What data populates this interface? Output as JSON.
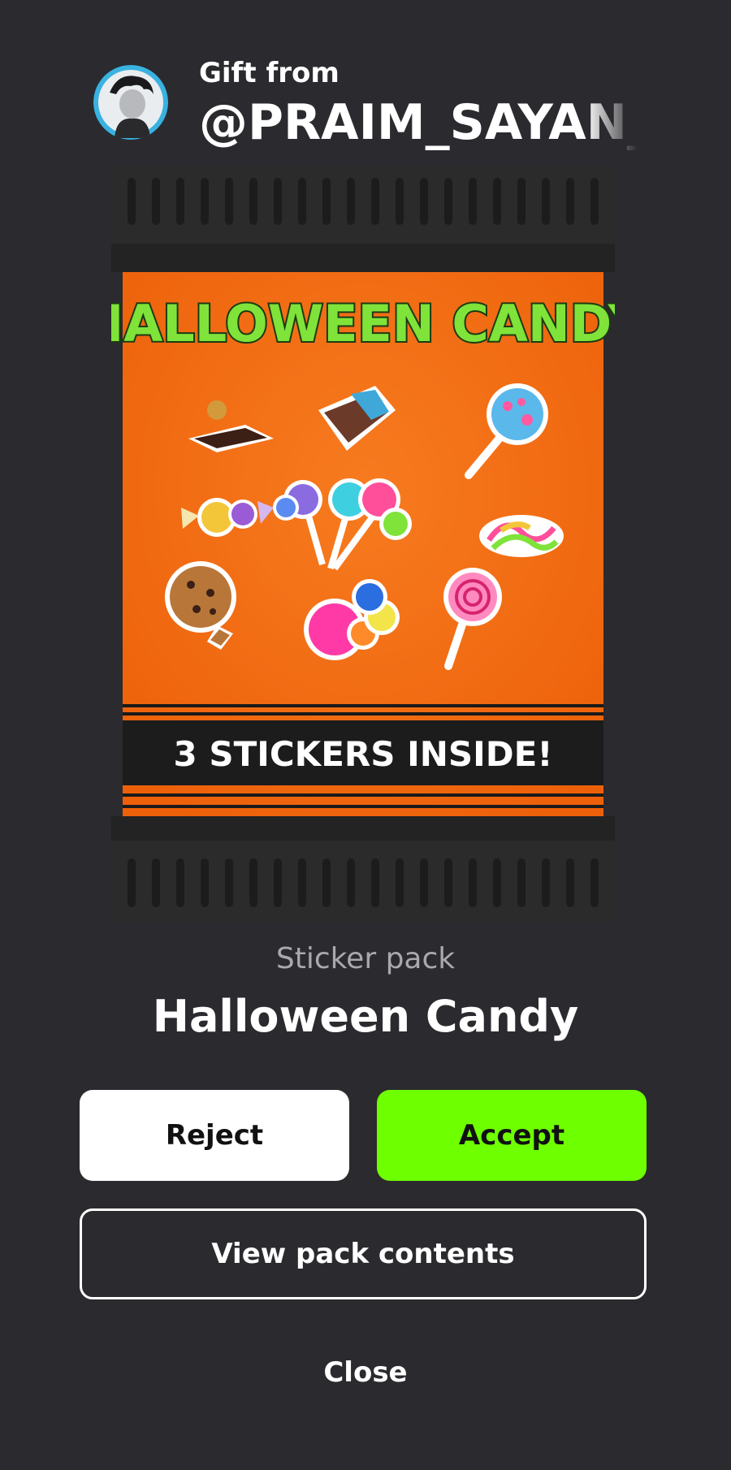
{
  "header": {
    "label": "Gift from",
    "username": "@PRAIM_SAYAN_V"
  },
  "pack": {
    "title_art": "HALLOWEEN CANDY",
    "banner": "3 STICKERS INSIDE!",
    "type_label": "Sticker pack",
    "name": "Halloween Candy"
  },
  "buttons": {
    "reject": "Reject",
    "accept": "Accept",
    "view": "View pack contents",
    "close": "Close"
  },
  "colors": {
    "background": "#2b2a2e",
    "accent_green": "#6eff00",
    "pack_orange": "#f36a10"
  }
}
